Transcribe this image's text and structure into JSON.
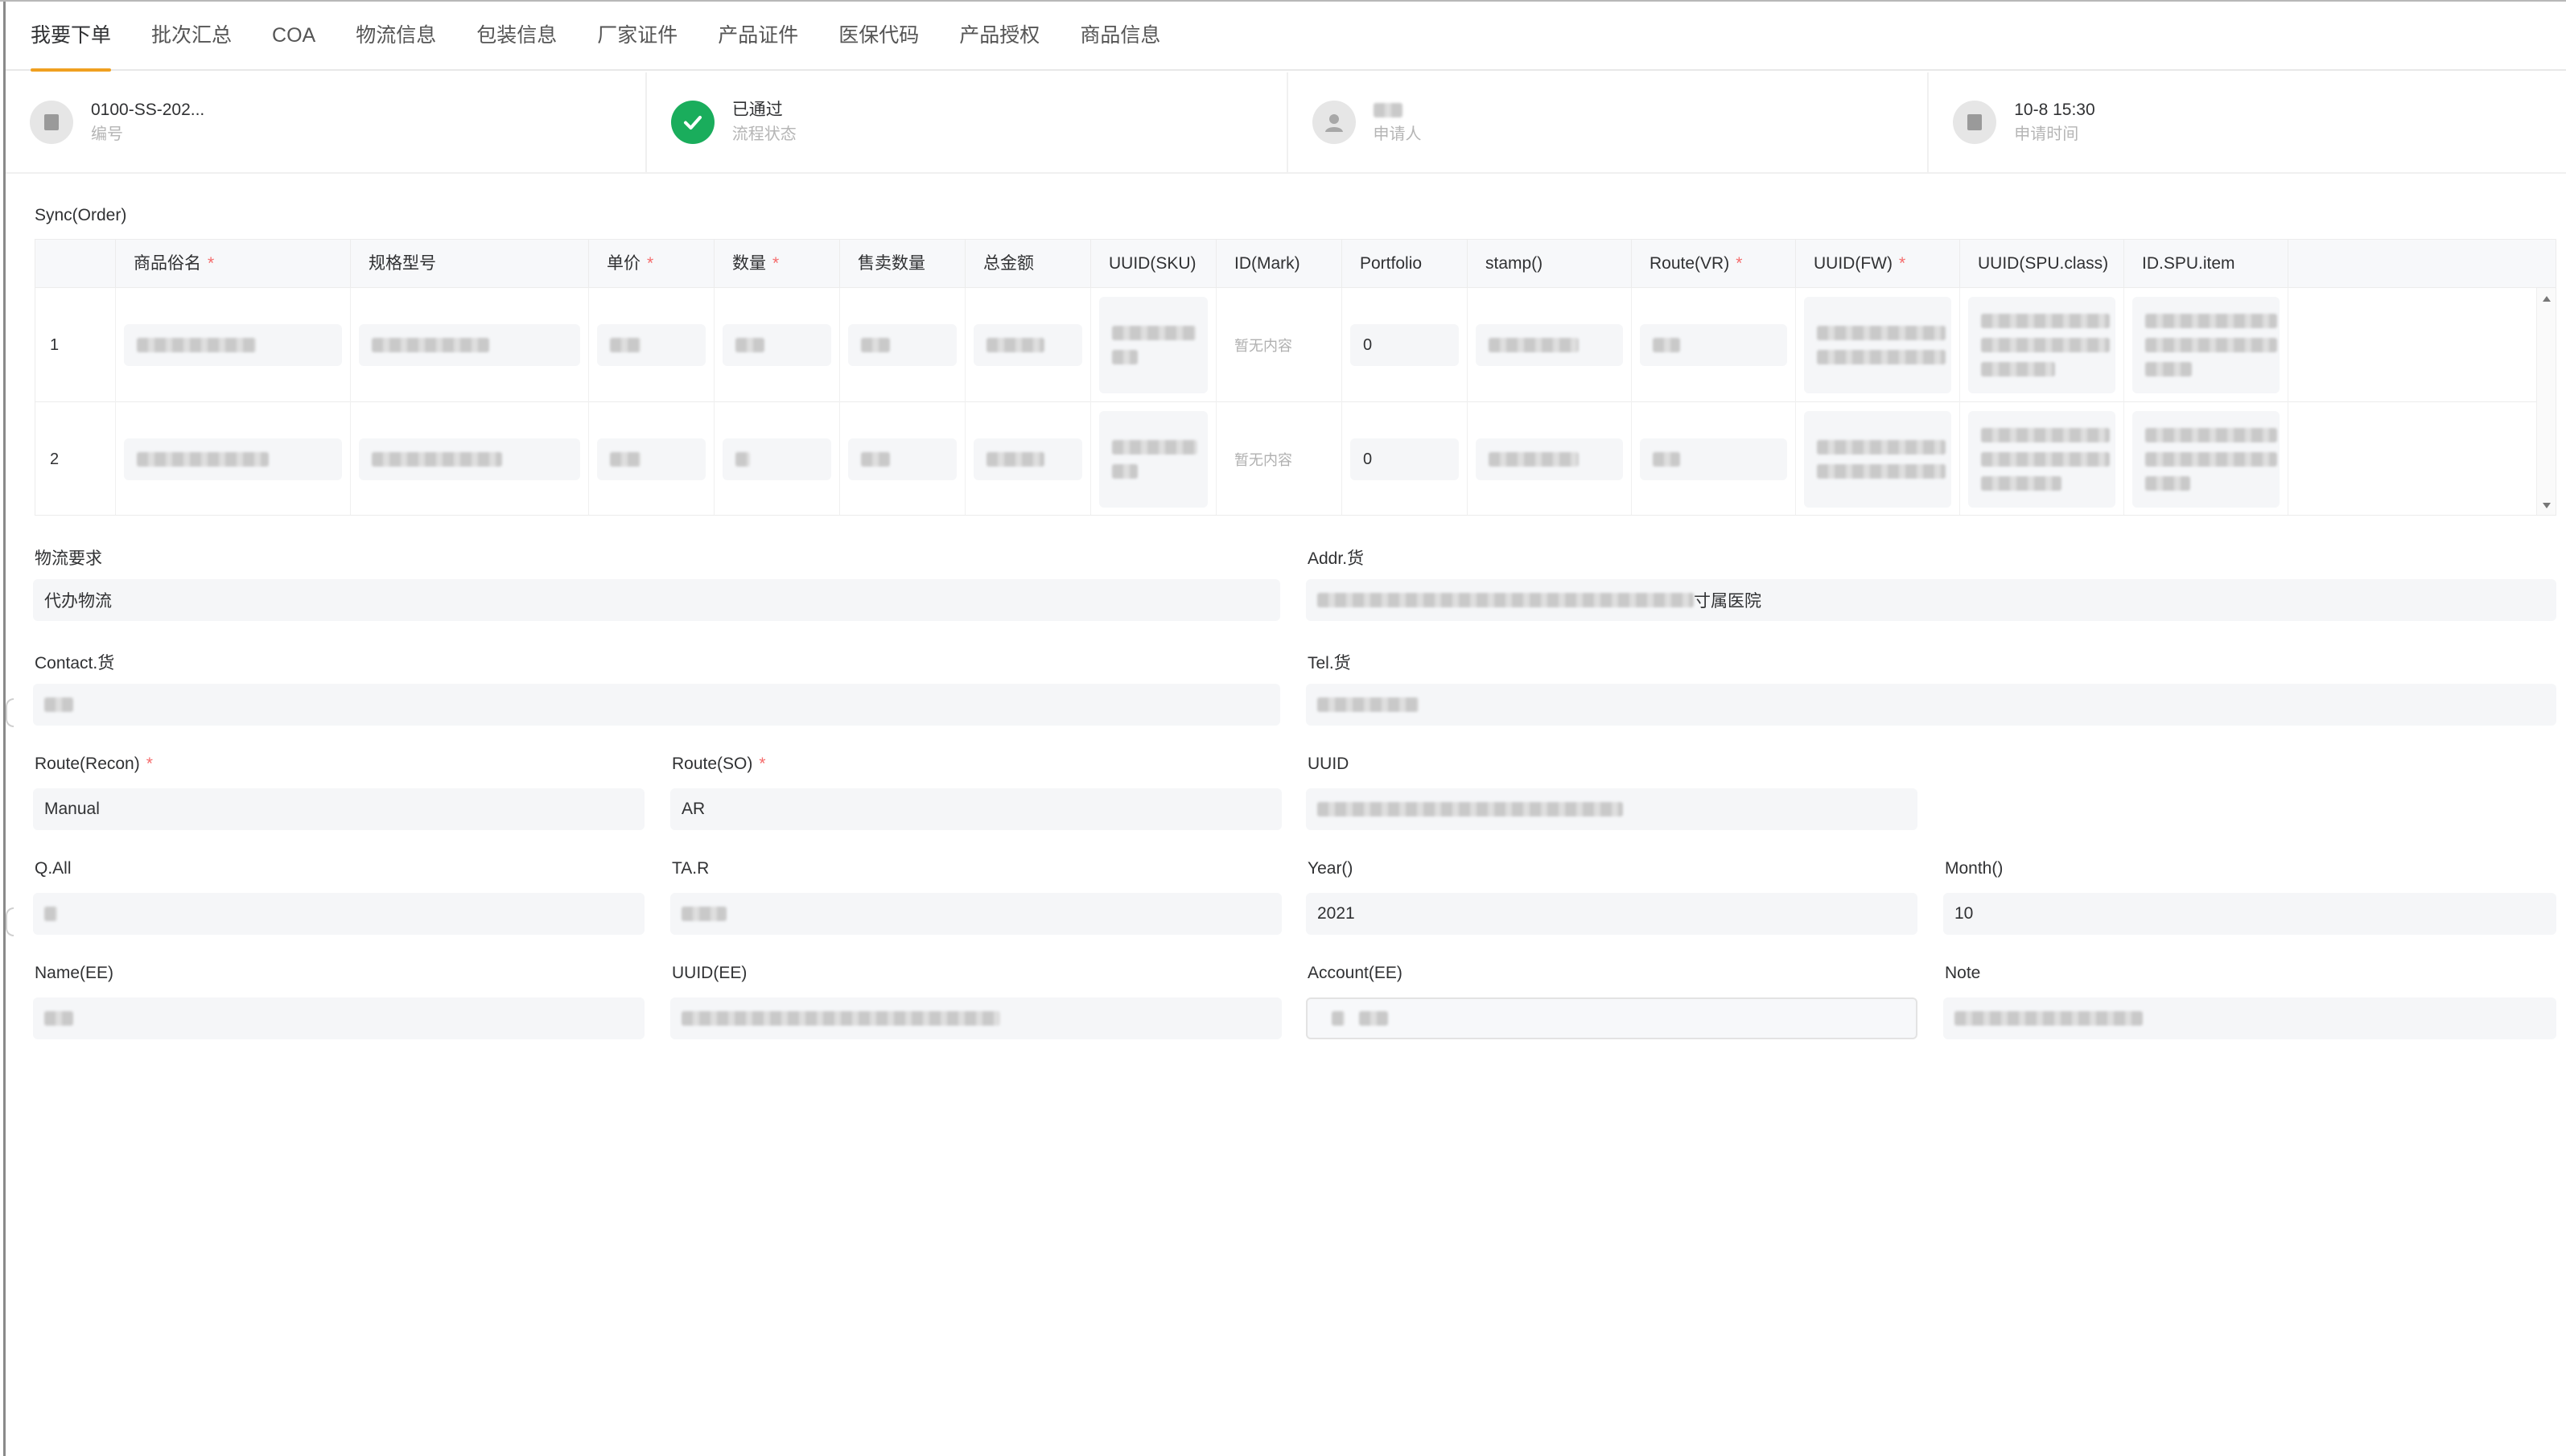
{
  "tabs": [
    "我要下单",
    "批次汇总",
    "COA",
    "物流信息",
    "包装信息",
    "厂家证件",
    "产品证件",
    "医保代码",
    "产品授权",
    "商品信息"
  ],
  "active_tab": 0,
  "info": {
    "number": {
      "value": "0100-SS-202...",
      "label": "编号"
    },
    "status": {
      "value": "已通过",
      "label": "流程状态"
    },
    "applicant": {
      "label": "申请人"
    },
    "time": {
      "value": "10-8 15:30",
      "label": "申请时间"
    }
  },
  "order": {
    "title": "Sync(Order)",
    "columns": [
      {
        "label": "商品俗名",
        "required": true
      },
      {
        "label": "规格型号",
        "required": false
      },
      {
        "label": "单价",
        "required": true
      },
      {
        "label": "数量",
        "required": true
      },
      {
        "label": "售卖数量",
        "required": false
      },
      {
        "label": "总金额",
        "required": false
      },
      {
        "label": "UUID(SKU)",
        "required": false
      },
      {
        "label": "ID(Mark)",
        "required": false
      },
      {
        "label": "Portfolio",
        "required": false
      },
      {
        "label": "stamp()",
        "required": false
      },
      {
        "label": "Route(VR)",
        "required": true
      },
      {
        "label": "UUID(FW)",
        "required": true
      },
      {
        "label": "UUID(SPU.class)",
        "required": false
      },
      {
        "label": "ID.SPU.item",
        "required": false
      }
    ],
    "rows": [
      {
        "index": "1",
        "mark": "暂无内容",
        "portfolio": "0"
      },
      {
        "index": "2",
        "mark": "暂无内容",
        "portfolio": "0"
      }
    ]
  },
  "form": {
    "logistics_req": {
      "label": "物流要求",
      "value": "代办物流"
    },
    "addr": {
      "label": "Addr.货",
      "value_suffix": "寸属医院"
    },
    "contact": {
      "label": "Contact.货"
    },
    "tel": {
      "label": "Tel.货"
    },
    "route_recon": {
      "label": "Route(Recon)",
      "value": "Manual",
      "required": true
    },
    "route_so": {
      "label": "Route(SO)",
      "value": "AR",
      "required": true
    },
    "uuid": {
      "label": "UUID"
    },
    "q_all": {
      "label": "Q.All"
    },
    "ta_r": {
      "label": "TA.R"
    },
    "year": {
      "label": "Year()",
      "value": "2021"
    },
    "month": {
      "label": "Month()",
      "value": "10"
    },
    "name_ee": {
      "label": "Name(EE)"
    },
    "uuid_ee": {
      "label": "UUID(EE)"
    },
    "account_ee": {
      "label": "Account(EE)"
    },
    "note": {
      "label": "Note"
    }
  },
  "colors": {
    "accent": "#f0a020",
    "success": "#1aad5c",
    "required": "#f56c6c"
  }
}
